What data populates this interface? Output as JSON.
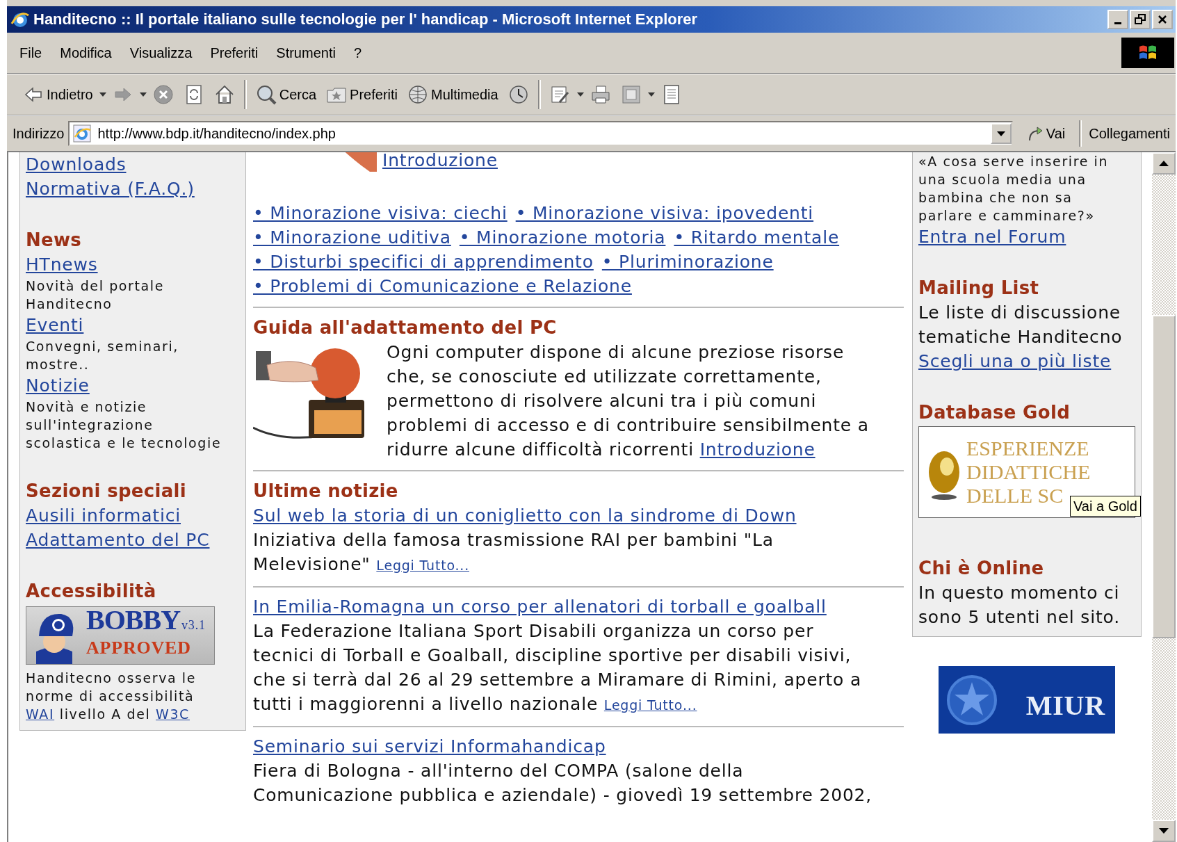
{
  "window": {
    "title": "Handitecno :: Il portale italiano sulle tecnologie per l' handicap - Microsoft Internet Explorer"
  },
  "menu": [
    "File",
    "Modifica",
    "Visualizza",
    "Preferiti",
    "Strumenti",
    "?"
  ],
  "toolbar": [
    {
      "kind": "back",
      "label": "Indietro",
      "dropdown": true
    },
    {
      "kind": "forward",
      "dropdown": true
    },
    {
      "kind": "stop",
      "dropdown": false
    },
    {
      "kind": "refresh",
      "dropdown": false
    },
    {
      "kind": "home",
      "dropdown": false
    },
    {
      "kind": "search",
      "label": "Cerca",
      "dropdown": false
    },
    {
      "kind": "favorites",
      "label": "Preferiti",
      "dropdown": false
    },
    {
      "kind": "media",
      "label": "Multimedia",
      "dropdown": false
    },
    {
      "kind": "history",
      "dropdown": false
    },
    {
      "kind": "mail",
      "dropdown": true
    },
    {
      "kind": "print",
      "dropdown": false
    },
    {
      "kind": "edit",
      "dropdown": true
    },
    {
      "kind": "discuss",
      "dropdown": false
    }
  ],
  "address_bar": {
    "label": "Indirizzo",
    "value": "http://www.bdp.it/handitecno/index.php",
    "go": "Vai",
    "links": "Collegamenti"
  },
  "left_column": {
    "blocks": [
      {
        "kind": "link",
        "text": "Downloads"
      },
      {
        "kind": "link",
        "text": "Normativa (F.A.Q.)"
      },
      {
        "kind": "heading",
        "text": "News"
      },
      {
        "kind": "link",
        "text": "HTnews"
      },
      {
        "kind": "note",
        "lines": [
          "Novità del portale",
          "Handitecno"
        ]
      },
      {
        "kind": "link",
        "text": "Eventi"
      },
      {
        "kind": "note",
        "lines": [
          "Convegni, seminari,",
          "mostre.."
        ]
      },
      {
        "kind": "link",
        "text": "Notizie"
      },
      {
        "kind": "note",
        "lines": [
          "Novità e notizie",
          "sull'integrazione",
          "scolastica e le tecnologie"
        ]
      },
      {
        "kind": "heading",
        "text": "Sezioni speciali"
      },
      {
        "kind": "link",
        "text": "Ausili informatici"
      },
      {
        "kind": "link",
        "text": "Adattamento del PC"
      },
      {
        "kind": "heading",
        "text": "Accessibilità"
      },
      {
        "kind": "bobby_badge",
        "title": "BOBBY",
        "version": "v3.1",
        "subtitle": "APPROVED"
      },
      {
        "kind": "sentence",
        "lines": [
          [
            {
              "text": "Handitecno osserva le"
            }
          ],
          [
            {
              "text": "norme di accessibilità"
            }
          ],
          [
            {
              "link": "WAI"
            },
            {
              "text": " livello A del "
            },
            {
              "link": "W3C"
            }
          ]
        ]
      }
    ]
  },
  "center_column": {
    "blocks": [
      {
        "kind": "top_link",
        "text": "Introduzione"
      },
      {
        "kind": "category_links",
        "rows": [
          [
            "• Minorazione visiva: ciechi",
            "• Minorazione visiva: ipovedenti"
          ],
          [
            "• Minorazione uditiva",
            "• Minorazione motoria",
            "• Ritardo mentale"
          ],
          [
            "• Disturbi specifici di apprendimento",
            "• Pluriminorazione"
          ],
          [
            "• Problemi di Comunicazione e Relazione"
          ]
        ]
      },
      {
        "kind": "rule"
      },
      {
        "kind": "heading",
        "text": "Guida all'adattamento del PC"
      },
      {
        "kind": "feature",
        "lines": [
          "Ogni computer dispone di alcune preziose risorse",
          "che, se conosciute ed utilizzate correttamente,",
          "permettono di risolvere alcuni tra i più comuni",
          "problemi di accesso e di contribuire sensibilmente a",
          "ridurre alcune difficoltà ricorrenti"
        ],
        "link": "Introduzione"
      },
      {
        "kind": "rule"
      },
      {
        "kind": "heading",
        "text": "Ultime notizie"
      },
      {
        "kind": "news",
        "title": "Sul web la storia di un coniglietto con la sindrome di Down",
        "lines": [
          "Iniziativa della famosa trasmissione RAI per bambini \"La",
          "Melevisione\""
        ],
        "more": "Leggi Tutto..."
      },
      {
        "kind": "rule"
      },
      {
        "kind": "news",
        "title": "In Emilia-Romagna un corso per allenatori di torball e goalball",
        "lines": [
          "La Federazione Italiana Sport Disabili organizza un corso per",
          "tecnici di Torball e Goalball, discipline sportive per disabili visivi,",
          "che si terrà dal 26 al 29 settembre a Miramare di Rimini, aperto a",
          "tutti i maggiorenni a livello nazionale"
        ],
        "more": "Leggi Tutto..."
      },
      {
        "kind": "rule"
      },
      {
        "kind": "news",
        "title": "Seminario sui servizi Informahandicap",
        "lines": [
          "Fiera di Bologna - all'interno del COMPA (salone della",
          "Comunicazione pubblica e aziendale) - giovedì 19 settembre 2002,"
        ]
      }
    ]
  },
  "right_column": {
    "blocks": [
      {
        "kind": "note",
        "lines": [
          "«A cosa serve inserire in",
          "una scuola media una",
          "bambina che non sa",
          "parlare e camminare?»"
        ]
      },
      {
        "kind": "link",
        "text": "Entra nel Forum"
      },
      {
        "kind": "heading",
        "text": "Mailing List"
      },
      {
        "kind": "text",
        "lines": [
          "Le liste di discussione",
          "tematiche Handitecno"
        ]
      },
      {
        "kind": "link",
        "text": "Scegli una o più liste"
      },
      {
        "kind": "heading",
        "text": "Database Gold"
      },
      {
        "kind": "gold_banner",
        "lines": [
          "ESPERIENZE",
          "DIDATTICHE",
          "DELLE SC"
        ],
        "tooltip": "Vai a Gold"
      },
      {
        "kind": "heading",
        "text": "Chi è Online"
      },
      {
        "kind": "text",
        "lines": [
          "In questo momento ci",
          "sono 5 utenti nel sito."
        ]
      }
    ],
    "below": [
      {
        "kind": "miur_logo",
        "text": "MIUR"
      }
    ]
  }
}
